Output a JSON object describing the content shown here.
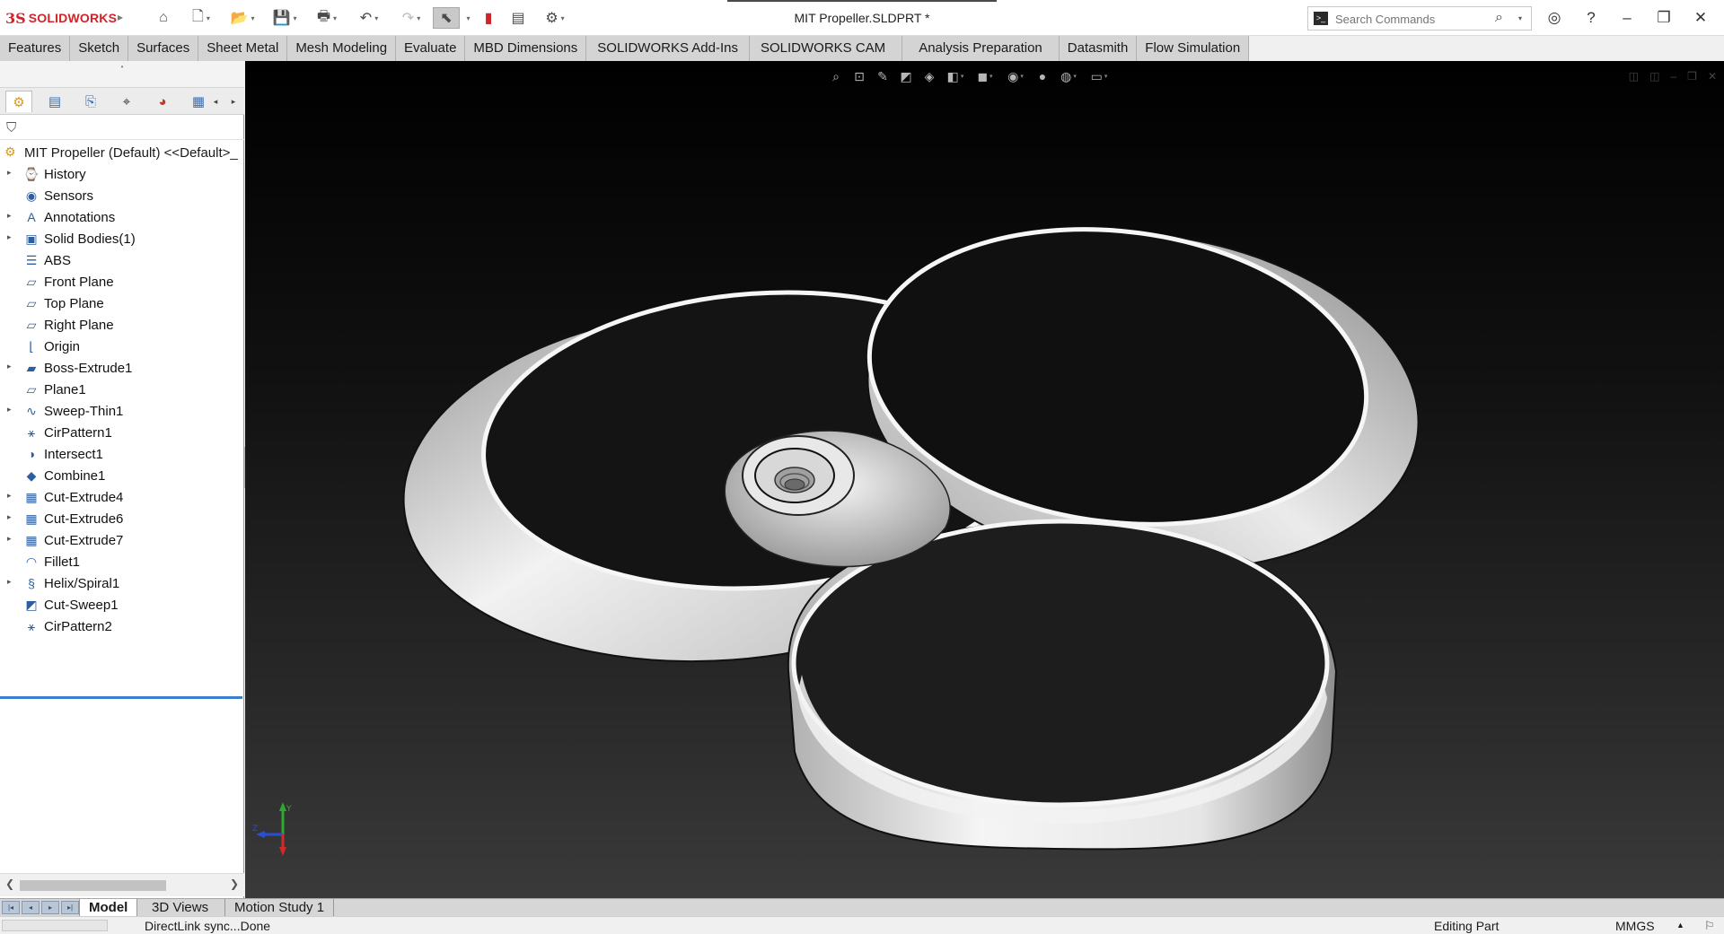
{
  "app": {
    "brand_mark": "3S",
    "brand_name": "SOLIDWORKS",
    "document_title": "MIT Propeller.SLDPRT *"
  },
  "search": {
    "placeholder": "Search Commands",
    "value": ""
  },
  "quick_access": [
    {
      "name": "home-icon",
      "glyph": "⌂"
    },
    {
      "name": "new-document-icon",
      "glyph": "🗋"
    },
    {
      "name": "open-icon",
      "glyph": "📂"
    },
    {
      "name": "save-icon",
      "glyph": "💾"
    },
    {
      "name": "print-icon",
      "glyph": "🖶"
    },
    {
      "name": "undo-icon",
      "glyph": "↶"
    },
    {
      "name": "redo-icon",
      "glyph": "↷"
    },
    {
      "name": "select-icon",
      "glyph": "⬉"
    },
    {
      "name": "rebuild-icon",
      "glyph": "▮"
    },
    {
      "name": "file-properties-icon",
      "glyph": "▤"
    },
    {
      "name": "options-icon",
      "glyph": "⚙"
    }
  ],
  "command_tabs": [
    "Features",
    "Sketch",
    "Surfaces",
    "Sheet Metal",
    "Mesh Modeling",
    "Evaluate",
    "MBD Dimensions",
    "SOLIDWORKS Add-Ins",
    "SOLIDWORKS CAM",
    "Analysis Preparation",
    "Datasmith",
    "Flow Simulation"
  ],
  "feature_tree": {
    "root": "MIT Propeller (Default) <<Default>_",
    "items": [
      {
        "label": "History",
        "icon": "history-icon",
        "expandable": true
      },
      {
        "label": "Sensors",
        "icon": "sensors-icon",
        "expandable": false
      },
      {
        "label": "Annotations",
        "icon": "annotations-icon",
        "expandable": true
      },
      {
        "label": "Solid Bodies(1)",
        "icon": "solid-bodies-icon",
        "expandable": true
      },
      {
        "label": "ABS",
        "icon": "material-icon",
        "expandable": false
      },
      {
        "label": "Front Plane",
        "icon": "plane-icon",
        "expandable": false
      },
      {
        "label": "Top Plane",
        "icon": "plane-icon",
        "expandable": false
      },
      {
        "label": "Right Plane",
        "icon": "plane-icon",
        "expandable": false
      },
      {
        "label": "Origin",
        "icon": "origin-icon",
        "expandable": false
      },
      {
        "label": "Boss-Extrude1",
        "icon": "extrude-icon",
        "expandable": true
      },
      {
        "label": "Plane1",
        "icon": "plane-icon",
        "expandable": false
      },
      {
        "label": "Sweep-Thin1",
        "icon": "sweep-icon",
        "expandable": true
      },
      {
        "label": "CirPattern1",
        "icon": "circular-pattern-icon",
        "expandable": false
      },
      {
        "label": "Intersect1",
        "icon": "intersect-icon",
        "expandable": false
      },
      {
        "label": "Combine1",
        "icon": "combine-icon",
        "expandable": false
      },
      {
        "label": "Cut-Extrude4",
        "icon": "cut-extrude-icon",
        "expandable": true
      },
      {
        "label": "Cut-Extrude6",
        "icon": "cut-extrude-icon",
        "expandable": true
      },
      {
        "label": "Cut-Extrude7",
        "icon": "cut-extrude-icon",
        "expandable": true
      },
      {
        "label": "Fillet1",
        "icon": "fillet-icon",
        "expandable": false
      },
      {
        "label": "Helix/Spiral1",
        "icon": "helix-icon",
        "expandable": true
      },
      {
        "label": "Cut-Sweep1",
        "icon": "cut-sweep-icon",
        "expandable": false
      },
      {
        "label": "CirPattern2",
        "icon": "circular-pattern-icon",
        "expandable": false
      }
    ]
  },
  "bottom_tabs": [
    "Model",
    "3D Views",
    "Motion Study 1"
  ],
  "status": {
    "message": "DirectLink sync...Done",
    "mode": "Editing Part",
    "units": "MMGS"
  },
  "colors": {
    "brand": "#d2232a",
    "viewport_top": "#000000",
    "viewport_bottom": "#3a3a3a",
    "tab_bg": "#d4d4d4",
    "accent": "#3a7ecf"
  }
}
